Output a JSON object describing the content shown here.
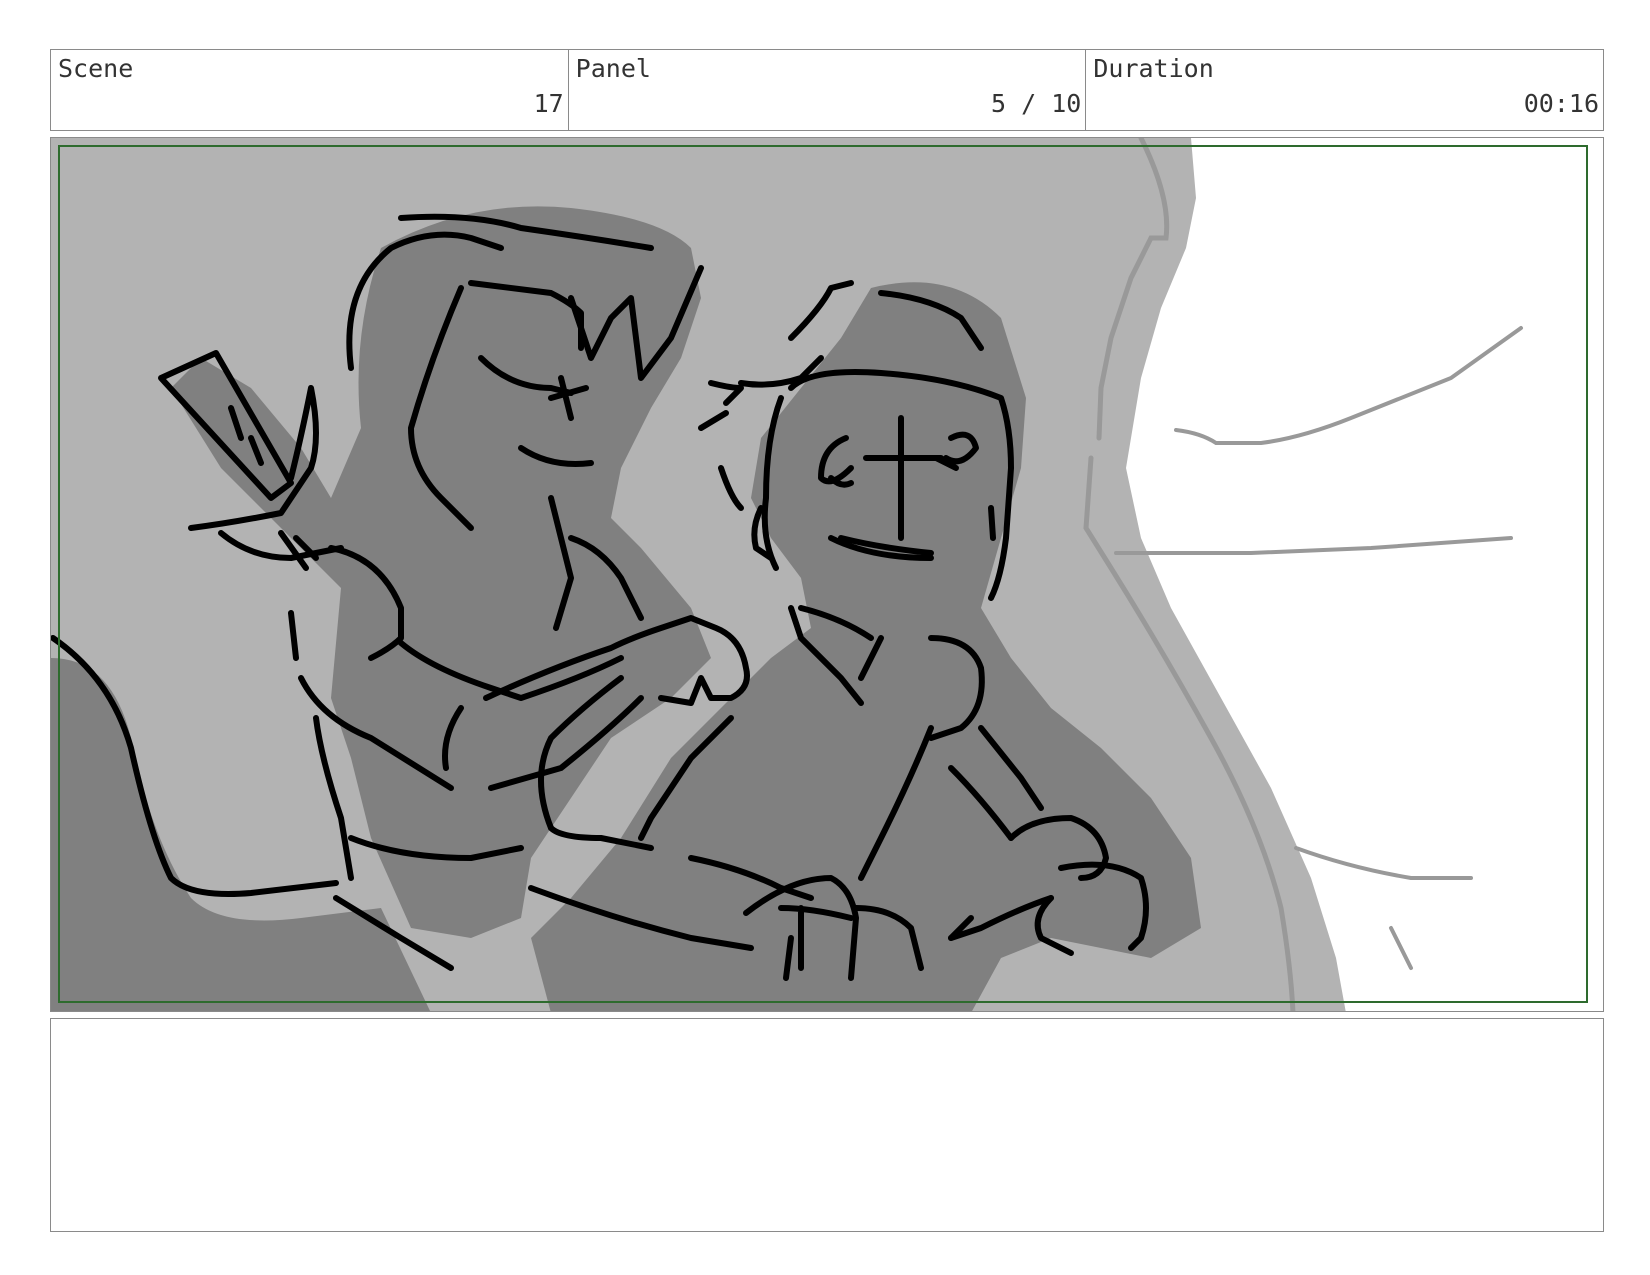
{
  "header": {
    "scene_label": "Scene",
    "scene_value": "17",
    "panel_label": "Panel",
    "panel_value": "5 / 10",
    "duration_label": "Duration",
    "duration_value": "00:16"
  },
  "frame": {
    "safe_area_color": "#2e6b2e",
    "fill_dark": "#808080",
    "fill_light": "#b3b3b3",
    "line_color": "#000000"
  },
  "notes": {
    "text": ""
  }
}
